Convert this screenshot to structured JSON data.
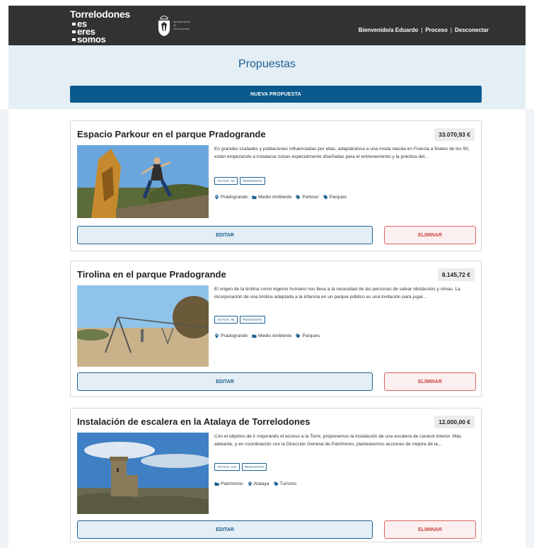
{
  "header": {
    "brand": {
      "line1": "Torrelodones",
      "line2": "es",
      "line3": "eres",
      "line4": "somos"
    },
    "ayuntamiento": [
      "Ayuntamiento",
      "de",
      "Torrelodones"
    ],
    "user_nav": {
      "welcome": "Bienvenido/a Eduardo",
      "sep": "|",
      "process": "Proceso",
      "logout": "Desconectar"
    }
  },
  "page": {
    "title": "Propuestas",
    "new_button": "NUEVA PROPUESTA"
  },
  "proposals": [
    {
      "title": "Espacio Parkour en el parque Pradogrande",
      "price": "33.070,93 €",
      "description": "En grandes ciudades y poblaciones influenciadas por ellas, adaptándose a una moda nacida en Francia a finales de los 90, están empezando a instalarse zonas especialmente diseñadas para el entrenamiento y la práctica del...",
      "votes": "VOTOS: 53",
      "status": "PENDIENTE",
      "tags": [
        {
          "icon": "location-pin-icon",
          "label": "Pradogrande"
        },
        {
          "icon": "folder-icon",
          "label": "Medio Ambiente"
        },
        {
          "icon": "tag-icon",
          "label": "Parkour"
        },
        {
          "icon": "tag-icon",
          "label": "Parques"
        }
      ],
      "edit": "EDITAR",
      "delete": "ELIMINAR"
    },
    {
      "title": "Tirolina en el parque Pradogrande",
      "price": "8.145,72 €",
      "description": "El origen de la tirolina como ingenio humano nos lleva a la necesidad de las personas de salvar obstáculos y simas. La incorporación de una tirolina adaptada a la infancia en un parque público es una invitación para jugar...",
      "votes": "VOTOS: 95",
      "status": "PENDIENTE",
      "tags": [
        {
          "icon": "location-pin-icon",
          "label": "Pradogrande"
        },
        {
          "icon": "folder-icon",
          "label": "Medio Ambiente"
        },
        {
          "icon": "tag-icon",
          "label": "Parques"
        }
      ],
      "edit": "EDITAR",
      "delete": "ELIMINAR"
    },
    {
      "title": "Instalación de escalera en la Atalaya de Torrelodones",
      "price": "12.000,00 €",
      "description": "Con el objetivo de ir mejorando el acceso a la Torre, proponemos la instalación de una escalera de caracol interior. Más adelante, y en coordinación con la Dirección General de Patrimonio, plantearemos acciones de mejora de la...",
      "votes": "VOTOS: 102",
      "status": "PENDIENTE",
      "tags": [
        {
          "icon": "folder-icon",
          "label": "Patrimonio"
        },
        {
          "icon": "location-pin-icon",
          "label": "Atalaya"
        },
        {
          "icon": "tag-icon",
          "label": "Turismo"
        }
      ],
      "edit": "EDITAR",
      "delete": "ELIMINAR"
    }
  ],
  "colors": {
    "header_bg": "#323232",
    "band_bg": "#e4eef5",
    "primary": "#0b5a8e",
    "danger": "#c94545"
  }
}
